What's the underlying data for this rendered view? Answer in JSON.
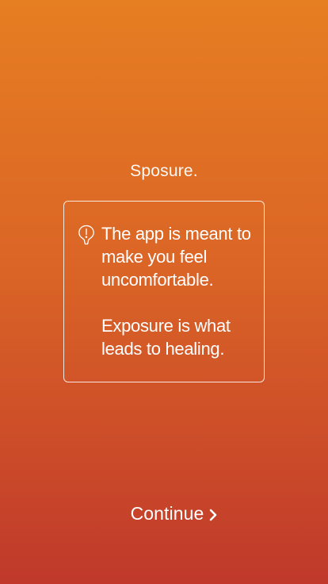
{
  "app": {
    "title": "Sposure."
  },
  "notice": {
    "icon": "lightbulb-exclamation-icon",
    "paragraph_1": "The app is meant to make you feel uncomfortable.",
    "paragraph_2": "Exposure is what leads to healing."
  },
  "actions": {
    "continue_label": "Continue",
    "continue_icon": "chevron-right-icon"
  },
  "colors": {
    "gradient_top": "#e67e22",
    "gradient_bottom": "#c0392b",
    "text": "#ffffff"
  }
}
